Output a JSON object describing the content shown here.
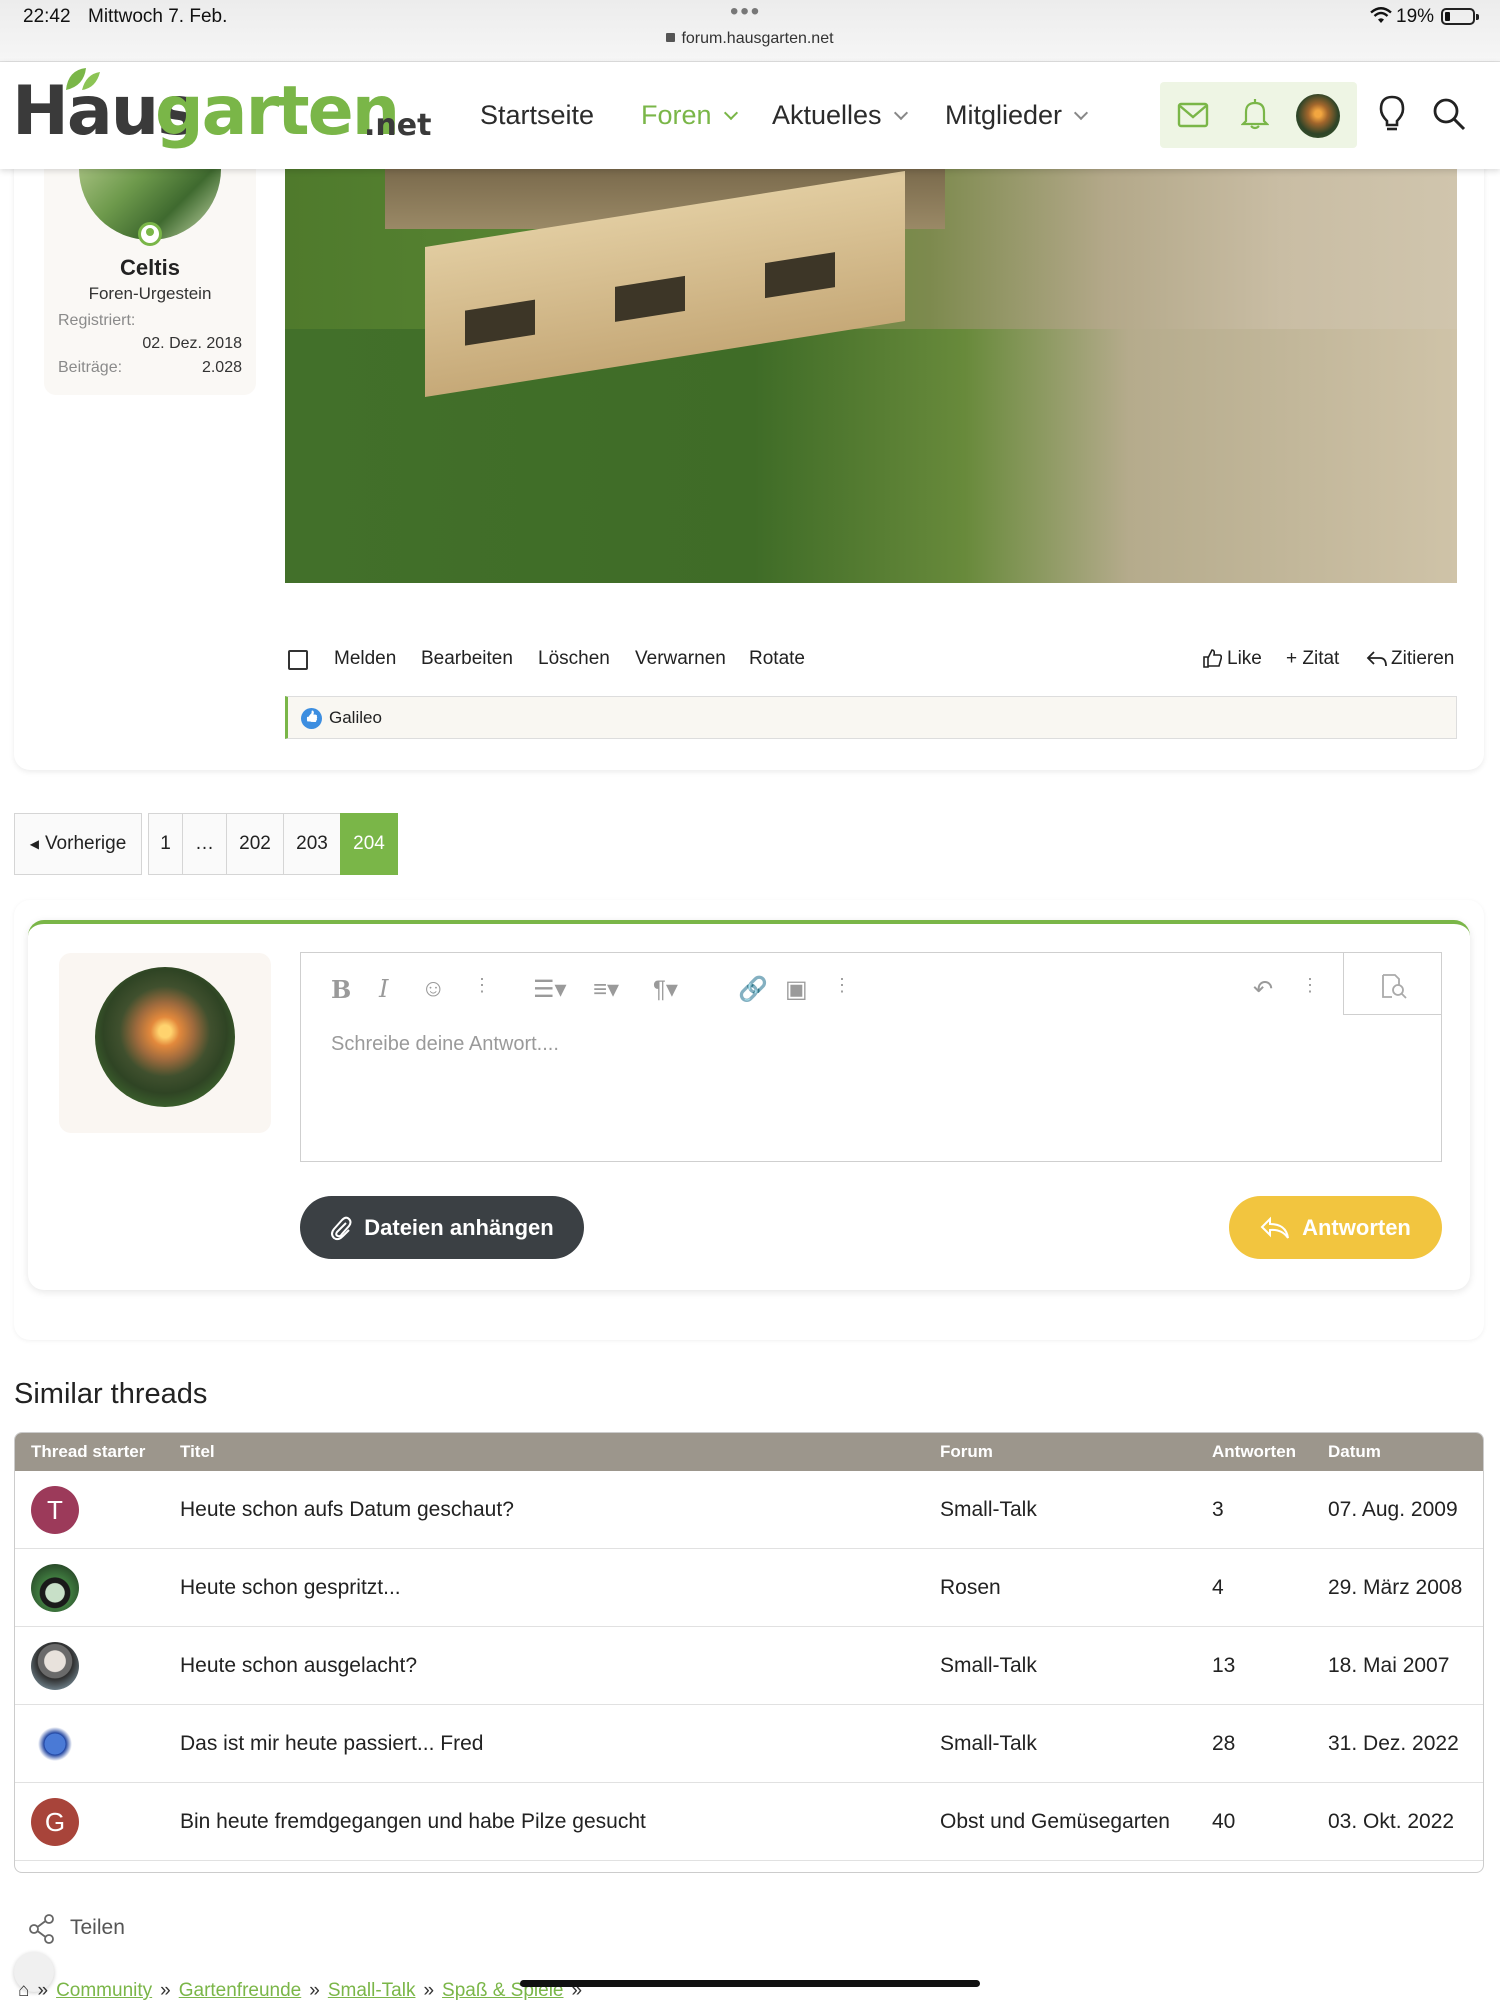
{
  "status_bar": {
    "time": "22:42",
    "date": "Mittwoch 7. Feb.",
    "battery": "19%",
    "url": "forum.hausgarten.net"
  },
  "header": {
    "logo": {
      "part1": "Haus",
      "part2": "garten",
      "part3": ".net"
    },
    "nav": [
      {
        "label": "Startseite"
      },
      {
        "label": "Foren"
      },
      {
        "label": "Aktuelles"
      },
      {
        "label": "Mitglieder"
      }
    ],
    "icons": [
      "mail-icon",
      "bell-icon",
      "avatar",
      "lightbulb-icon",
      "search-icon"
    ]
  },
  "post": {
    "user": {
      "name": "Celtis",
      "title": "Foren-Urgestein",
      "registered_label": "Registriert:",
      "registered_value": "02. Dez. 2018",
      "posts_label": "Beiträge:",
      "posts_value": "2.028"
    },
    "actions": [
      "Melden",
      "Bearbeiten",
      "Löschen",
      "Verwarnen",
      "Rotate"
    ],
    "right_actions": [
      "Like",
      "+ Zitat",
      "Zitieren"
    ],
    "reaction_user": "Galileo"
  },
  "pagination": {
    "prev": "Vorherige",
    "pages": [
      "1",
      "…",
      "202",
      "203",
      "204"
    ],
    "current": "204"
  },
  "reply": {
    "placeholder": "Schreibe deine Antwort....",
    "attach_label": "Dateien anhängen",
    "submit_label": "Antworten"
  },
  "similar": {
    "title": "Similar threads",
    "columns": [
      "Thread starter",
      "Titel",
      "Forum",
      "Antworten",
      "Datum"
    ],
    "rows": [
      {
        "avatar": "T",
        "title": "Heute schon aufs Datum geschaut?",
        "forum": "Small-Talk",
        "replies": "3",
        "date": "07. Aug. 2009"
      },
      {
        "avatar": "",
        "title": "Heute schon gespritzt...",
        "forum": "Rosen",
        "replies": "4",
        "date": "29. März 2008"
      },
      {
        "avatar": "",
        "title": "Heute schon ausgelacht?",
        "forum": "Small-Talk",
        "replies": "13",
        "date": "18. Mai 2007"
      },
      {
        "avatar": "",
        "title": "Das ist mir heute passiert... Fred",
        "forum": "Small-Talk",
        "replies": "28",
        "date": "31. Dez. 2022"
      },
      {
        "avatar": "G",
        "title": "Bin heute fremdgegangen und habe Pilze gesucht",
        "forum": "Obst und Gemüsegarten",
        "replies": "40",
        "date": "03. Okt. 2022"
      }
    ]
  },
  "footer": {
    "share": "Teilen",
    "breadcrumb": [
      "Community",
      "Gartenfreunde",
      "Small-Talk",
      "Spaß & Spiele"
    ]
  },
  "colors": {
    "accent": "#7ab648",
    "reply_button": "#f2c53f",
    "attach_button": "#3b4044",
    "table_header": "#9c968c"
  }
}
